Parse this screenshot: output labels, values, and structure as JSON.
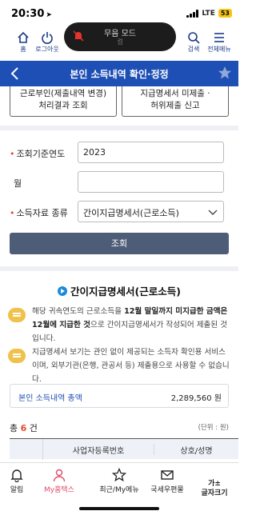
{
  "status_bar": {
    "time": "20:30",
    "network": "LTE",
    "battery": "53"
  },
  "toast": {
    "title": "무음 모드",
    "subtitle": "켬"
  },
  "app_header": {
    "home_label": "홈",
    "logout_label": "로그아웃",
    "search_label": "검색",
    "menu_label": "전체메뉴"
  },
  "title_bar": {
    "title": "본인 소득내역 확인·정정"
  },
  "actions": {
    "left_line1": "근로부인(제출내역 변경)",
    "left_line2": "처리결과 조회",
    "right_line1": "지급명세서 미제출 ·",
    "right_line2": "허위제출 신고"
  },
  "form": {
    "year_label": "조회기준연도",
    "year_value": "2023",
    "month_label": "월",
    "month_value": "",
    "type_label": "소득자료 종류",
    "type_value": "간이지급명세서(근로소득)",
    "search_button": "조회"
  },
  "result": {
    "section_title": "간이지급명세서(근로소득)",
    "note1_prefix": "해당 귀속연도의 근로소득을 ",
    "note1_bold": "12월 말일까지 미지급한 금액은 12월에 지급한 것",
    "note1_suffix": "으로 간이지급명세서가 작성되어 제출된 것입니다.",
    "note2": "지급명세서 보기는 관인 없이 제공되는 소득자 확인용 서비스이며, 외부기관(은행, 관공서 등) 제출용으로 사용할 수 없습니다.",
    "summary_label": "본인 소득내역 총액",
    "summary_value": "2,289,560 원",
    "count_prefix": "총 ",
    "count_value": "6",
    "count_suffix": " 건",
    "unit_label": "(단위 : 원)",
    "table_headers": [
      "사업자등록번호",
      "상호/성명"
    ]
  },
  "bottom_nav": {
    "items": [
      {
        "label": "알림",
        "icon": "bell-icon"
      },
      {
        "label": "My홈택스",
        "icon": "person-icon"
      },
      {
        "label": "최근/My메뉴",
        "icon": "star-icon"
      },
      {
        "label": "국세우편물",
        "icon": "mail-icon"
      },
      {
        "label": "가±\n글자크기",
        "icon": "font-size-icon"
      }
    ]
  },
  "colors": {
    "primary": "#1e4fb5",
    "accent": "#e14b2a",
    "button": "#4d5d78",
    "active_nav": "#e14b6a"
  }
}
